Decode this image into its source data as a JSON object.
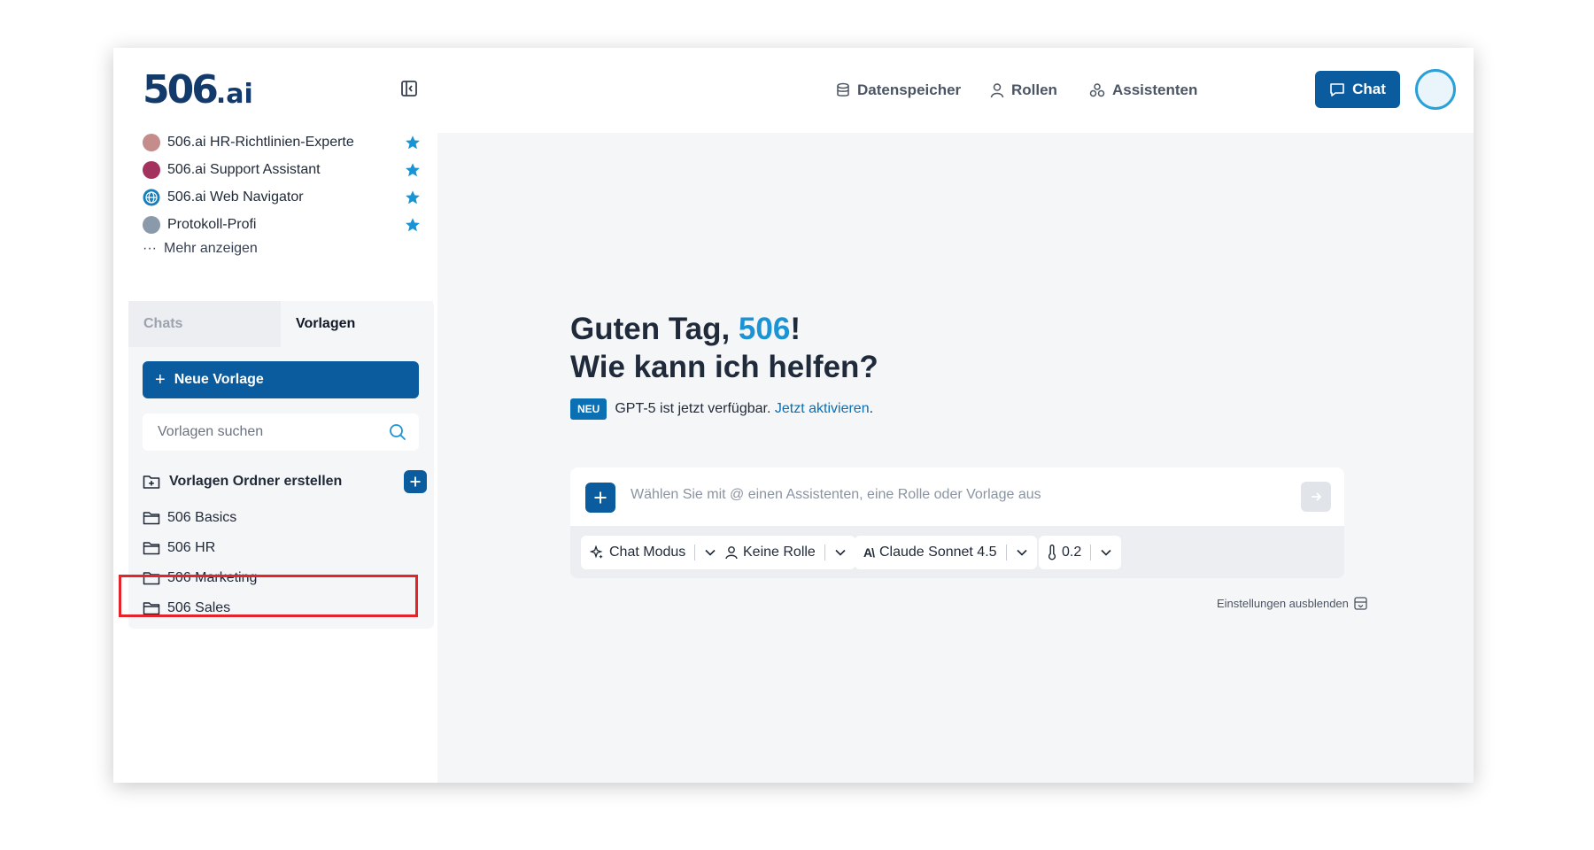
{
  "header": {
    "logo_main": "506",
    "logo_suffix": ".ai",
    "nav": [
      {
        "label": "Datenspeicher",
        "icon": "database-icon"
      },
      {
        "label": "Rollen",
        "icon": "user-icon"
      },
      {
        "label": "Assistenten",
        "icon": "assistants-icon"
      }
    ],
    "chat_button": "Chat"
  },
  "sidebar": {
    "favorites": [
      {
        "label": "506.ai HR-Richtlinien-Experte",
        "icon_color": "#c58c8c"
      },
      {
        "label": "506.ai Support Assistant",
        "icon_color": "#a3325e"
      },
      {
        "label": "506.ai Web Navigator",
        "icon_color": "#1a7fb8"
      },
      {
        "label": "Protokoll-Profi",
        "icon_color": "#8a9aab"
      }
    ],
    "more": "Mehr anzeigen",
    "tabs": {
      "chats": "Chats",
      "templates": "Vorlagen"
    },
    "new_template": "Neue Vorlage",
    "search_placeholder": "Vorlagen suchen",
    "create_folder": "Vorlagen Ordner erstellen",
    "folders": [
      "506 Basics",
      "506 HR",
      "506 Marketing",
      "506 Sales"
    ]
  },
  "main": {
    "greeting_prefix": "Guten Tag, ",
    "greeting_name": "506",
    "greeting_suffix": "!",
    "greeting_line2": "Wie kann ich helfen?",
    "badge": "NEU",
    "notice": "GPT-5 ist jetzt verfügbar.",
    "notice_link": "Jetzt aktivieren",
    "notice_end": ".",
    "prompt_placeholder": "Wählen Sie mit @ einen Assistenten, eine Rolle oder Vorlage aus",
    "chips": {
      "mode": "Chat Modus",
      "role": "Keine Rolle",
      "model": "Claude Sonnet 4.5",
      "temperature": "0.2"
    },
    "hide_settings": "Einstellungen ausblenden"
  },
  "colors": {
    "primary": "#0b5c9e",
    "accent": "#1a94d4",
    "highlight": "#e5232a"
  }
}
